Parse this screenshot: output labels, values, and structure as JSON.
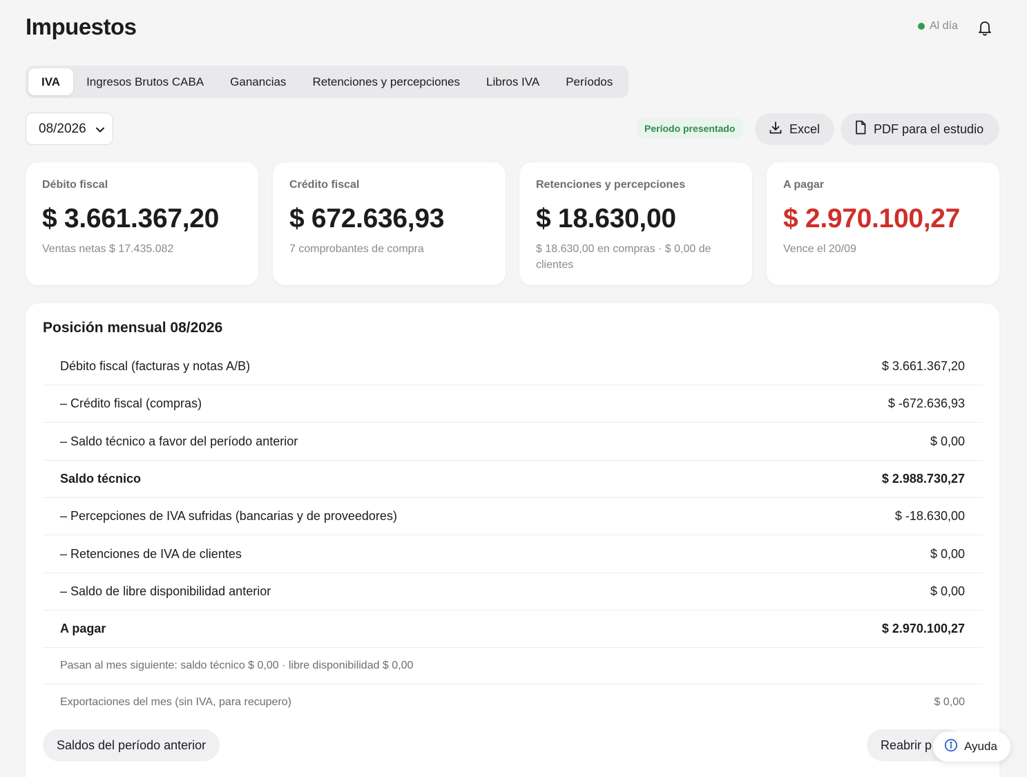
{
  "header": {
    "title": "Impuestos",
    "status_label": "Al día",
    "status_color": "#2e9e52"
  },
  "tabs": [
    {
      "label": "IVA",
      "active": true
    },
    {
      "label": "Ingresos Brutos CABA",
      "active": false
    },
    {
      "label": "Ganancias",
      "active": false
    },
    {
      "label": "Retenciones y percepciones",
      "active": false
    },
    {
      "label": "Libros IVA",
      "active": false
    },
    {
      "label": "Períodos",
      "active": false
    }
  ],
  "toolbar": {
    "period_value": "08/2026",
    "badge": "Período presentado",
    "excel_label": "Excel",
    "pdf_label": "PDF para el estudio"
  },
  "cards": [
    {
      "label": "Débito fiscal",
      "value": "$ 3.661.367,20",
      "sub": "Ventas netas $ 17.435.082"
    },
    {
      "label": "Crédito fiscal",
      "value": "$ 672.636,93",
      "sub": "7 comprobantes de compra"
    },
    {
      "label": "Retenciones y percepciones",
      "value": "$ 18.630,00",
      "sub": "$ 18.630,00 en compras · $ 0,00 de clientes"
    },
    {
      "label": "A pagar",
      "value": "$ 2.970.100,27",
      "sub": "Vence el 20/09",
      "value_color": "#cf2f2a"
    }
  ],
  "position": {
    "title": "Posición mensual 08/2026",
    "rows": [
      {
        "label": "Débito fiscal (facturas y notas A/B)",
        "amount": "$ 3.661.367,20"
      },
      {
        "label": "– Crédito fiscal (compras)",
        "amount": "$ -672.636,93"
      },
      {
        "label": "– Saldo técnico a favor del período anterior",
        "amount": "$ 0,00"
      },
      {
        "label": "Saldo técnico",
        "amount": "$ 2.988.730,27"
      },
      {
        "label": "– Percepciones de IVA sufridas (bancarias y de proveedores)",
        "amount": "$ -18.630,00"
      },
      {
        "label": "– Retenciones de IVA de clientes",
        "amount": "$ 0,00"
      },
      {
        "label": "– Saldo de libre disponibilidad anterior",
        "amount": "$ 0,00"
      },
      {
        "label": "A pagar",
        "amount": "$ 2.970.100,27"
      },
      {
        "label": "Pasan al mes siguiente: saldo técnico $ 0,00 · libre disponibilidad $ 0,00",
        "amount": ""
      },
      {
        "label": "Exportaciones del mes (sin IVA, para recupero)",
        "amount": "$ 0,00"
      }
    ],
    "prev_balance_button": "Saldos del período anterior",
    "reopen_button": "Reabrir p"
  },
  "help": {
    "label": "Ayuda"
  }
}
